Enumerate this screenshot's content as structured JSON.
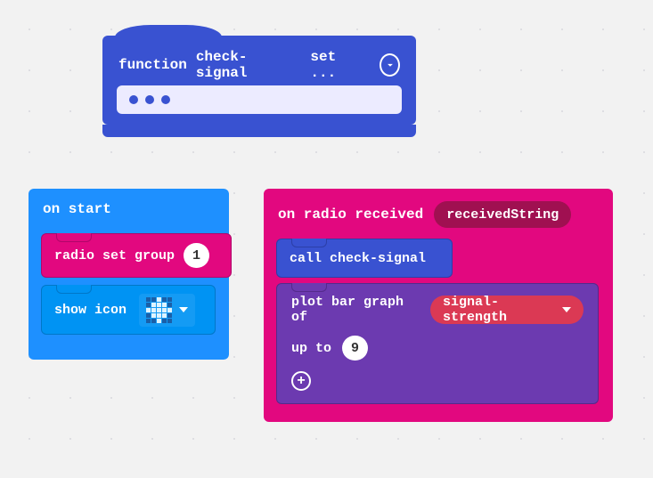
{
  "function_block": {
    "keyword": "function",
    "name": "check-signal",
    "trailing": "set ..."
  },
  "on_start": {
    "header": "on start",
    "radio_set_label": "radio set group",
    "radio_set_value": "1",
    "show_icon_label": "show icon"
  },
  "on_radio": {
    "header": "on radio received",
    "param": "receivedString",
    "call_prefix": "call",
    "call_target": "check-signal",
    "plot_label": "plot bar graph of",
    "plot_var": "signal-strength",
    "upto_label": "up to",
    "upto_value": "9"
  },
  "led_pattern": [
    [
      0,
      0,
      1,
      0,
      0
    ],
    [
      0,
      1,
      1,
      1,
      0
    ],
    [
      1,
      1,
      1,
      1,
      1
    ],
    [
      0,
      1,
      1,
      1,
      0
    ],
    [
      0,
      0,
      1,
      0,
      0
    ]
  ]
}
